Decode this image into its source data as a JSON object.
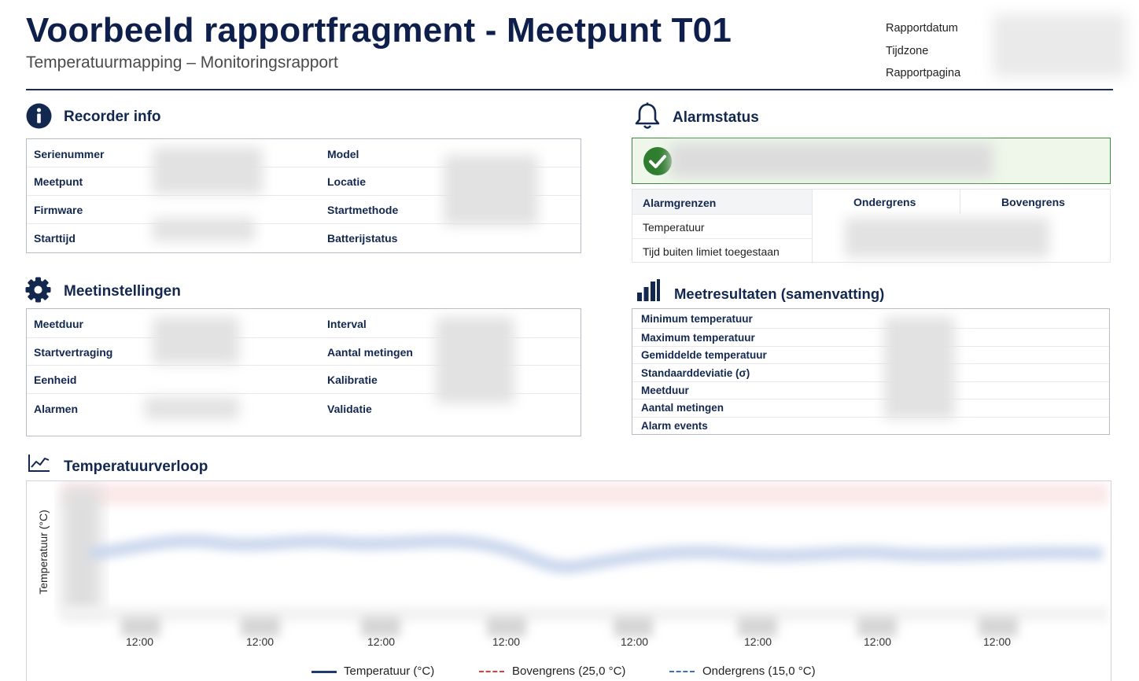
{
  "header": {
    "title": "Voorbeeld rapportfragment - Meetpunt T01",
    "subtitle": "Temperatuurmapping – Monitoringsrapport",
    "meta_labels": [
      "Rapportdatum",
      "Tijdzone",
      "Rapportpagina"
    ]
  },
  "recorder_info": {
    "title": "Recorder info",
    "left_labels": [
      "Serienummer",
      "Meetpunt",
      "Firmware",
      "Starttijd"
    ],
    "right_labels": [
      "Model",
      "Locatie",
      "Startmethode",
      "Batterijstatus"
    ]
  },
  "meetinstellingen": {
    "title": "Meetinstellingen",
    "left_labels": [
      "Meetduur",
      "Startvertraging",
      "Eenheid",
      "Alarmen"
    ],
    "right_labels": [
      "Interval",
      "Aantal metingen",
      "Kalibratie",
      "Validatie"
    ]
  },
  "alarmstatus": {
    "title": "Alarmstatus",
    "table_header": [
      "Alarmgrenzen",
      "Ondergrens",
      "Bovengrens"
    ],
    "rows": [
      "Temperatuur",
      "Tijd buiten limiet toegestaan"
    ]
  },
  "meetresultaten": {
    "title": "Meetresultaten (samenvatting)",
    "labels": [
      "Minimum temperatuur",
      "Maximum temperatuur",
      "Gemiddelde temperatuur",
      "Standaarddeviatie (σ)",
      "Meetduur",
      "Aantal metingen",
      "Alarm events"
    ]
  },
  "temperatuurverloop": {
    "title": "Temperatuurverloop",
    "ylabel": "Temperatuur (°C)",
    "x_ticks": [
      "12:00",
      "12:00",
      "12:00",
      "12:00",
      "12:00",
      "12:00",
      "12:00",
      "12:00"
    ],
    "legend": [
      "Temperatuur (°C)",
      "Bovengrens (25,0 °C)",
      "Ondergrens (15,0 °C)"
    ],
    "colors": {
      "temperature": "#1f3a6e",
      "upper": "#e03c3c",
      "lower": "#3a6fc9"
    }
  }
}
